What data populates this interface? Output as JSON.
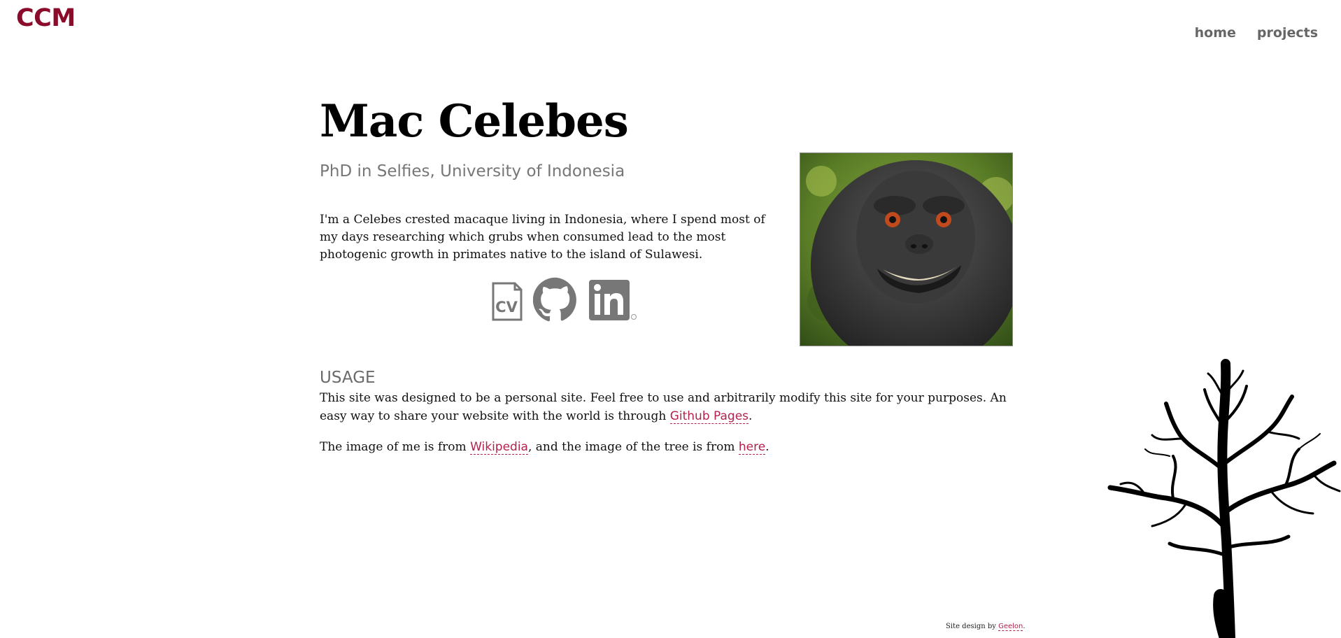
{
  "header": {
    "brand": "CCM",
    "nav": [
      {
        "label": "home"
      },
      {
        "label": "projects"
      }
    ]
  },
  "profile": {
    "name": "Mac Celebes",
    "subtitle": "PhD in Selfies, University of Indonesia",
    "bio": "I'm a Celebes crested macaque living in Indonesia, where I spend most of my days researching which grubs when consumed lead to the most photogenic growth in primates native to the island of Sulawesi.",
    "icons": [
      "cv-icon",
      "github-icon",
      "linkedin-icon"
    ],
    "cv_label": "CV"
  },
  "usage": {
    "heading": "USAGE",
    "para1_text": "This site was designed to be a personal site. Feel free to use and arbitrarily modify this site for your purposes. An easy way to share your website with the world is through ",
    "para1_link": "Github Pages",
    "para1_end": ".",
    "para2_start": "The image of me is from ",
    "para2_link1": "Wikipedia",
    "para2_mid": ", and the image of the tree is from ",
    "para2_link2": "here",
    "para2_end": "."
  },
  "footer": {
    "prefix": "Site design by ",
    "link": "Geelon",
    "suffix": "."
  },
  "colors": {
    "brand": "#8b0c2a",
    "link": "#b2224c",
    "nav": "#666666",
    "subtitle": "#777777",
    "icon_gray": "#777777"
  }
}
